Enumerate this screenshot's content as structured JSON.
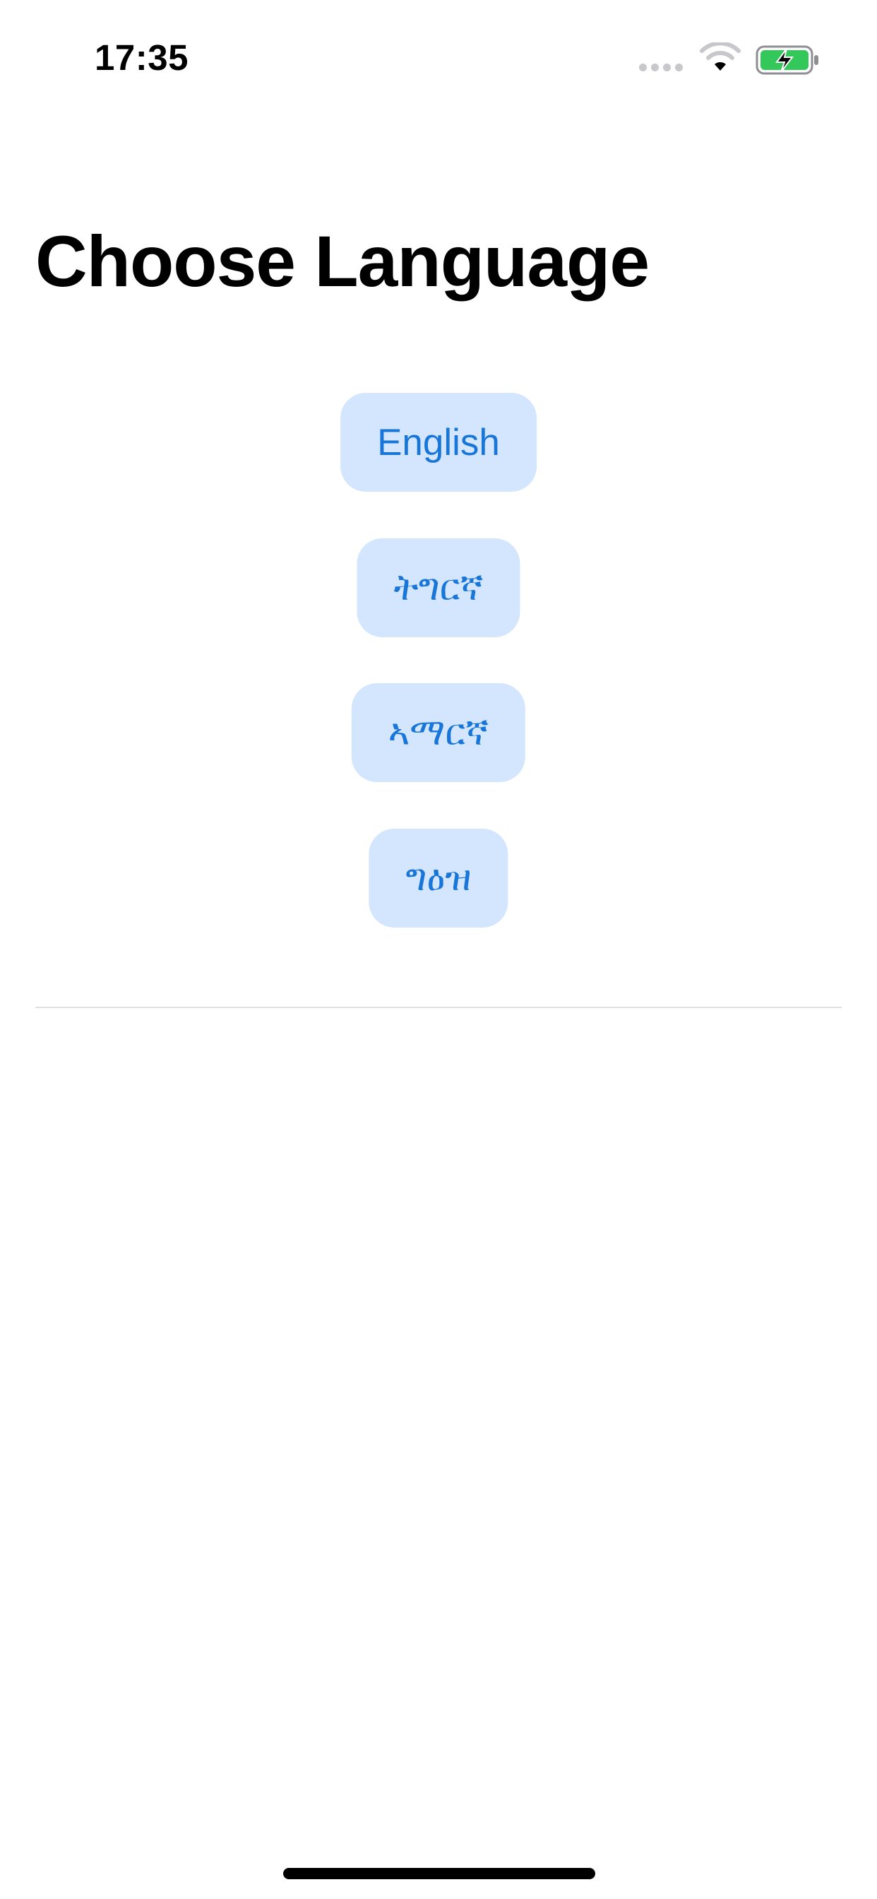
{
  "status_bar": {
    "time": "17:35",
    "icons": [
      "signal-dots-icon",
      "wifi-icon",
      "battery-charging-icon"
    ],
    "battery_color": "#34c759"
  },
  "page": {
    "title": "Choose Language"
  },
  "languages": [
    {
      "label": "English"
    },
    {
      "label": "ትግርኛ"
    },
    {
      "label": "ኣማርኛ"
    },
    {
      "label": "ግዕዝ"
    }
  ],
  "colors": {
    "button_background": "#d3e6fd",
    "button_text": "#1976d9",
    "divider": "#e0e0e3"
  }
}
